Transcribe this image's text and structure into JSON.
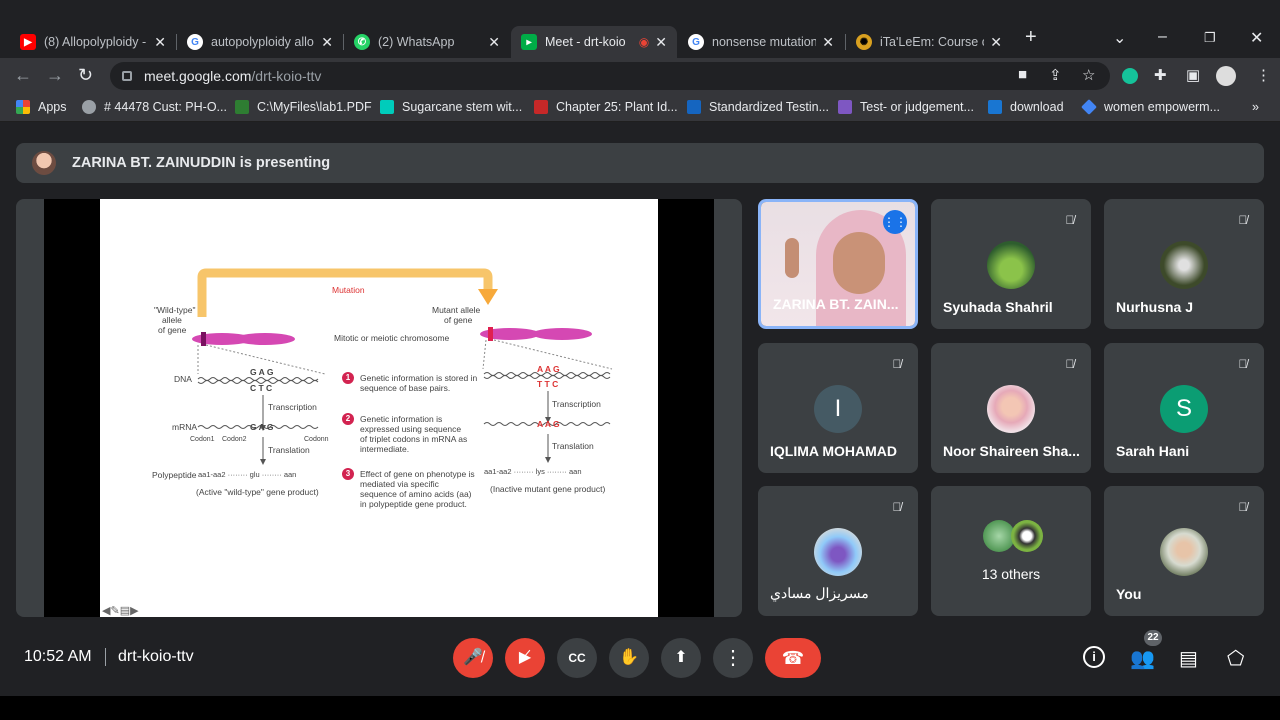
{
  "browser": {
    "tabs": [
      {
        "title": "(8) Allopolyploidy -",
        "icon": "youtube-icon",
        "color": "#ff0000"
      },
      {
        "title": "autopolyploidy allo",
        "icon": "google-icon",
        "color": "#4285f4"
      },
      {
        "title": "(2) WhatsApp",
        "icon": "whatsapp-icon",
        "color": "#25d366"
      },
      {
        "title": "Meet - drt-koio",
        "icon": "meet-icon",
        "color": "#00ac47"
      },
      {
        "title": "nonsense mutation",
        "icon": "google-icon",
        "color": "#4285f4"
      },
      {
        "title": "iTa'LeEm: Course ca",
        "icon": "italeem-icon",
        "color": "#d8a020"
      }
    ],
    "url_domain": "meet.google.com",
    "url_path": "/drt-koio-ttv",
    "bookmarks": [
      {
        "label": "Apps",
        "icon": "apps-grid-icon",
        "color": "#ea4335"
      },
      {
        "label": "# 44478 Cust: PH-O...",
        "icon": "globe-icon",
        "color": "#9aa0a6"
      },
      {
        "label": "C:\\MyFiles\\lab1.PDF",
        "icon": "folder-icon",
        "color": "#2e7d32"
      },
      {
        "label": "Sugarcane stem wit...",
        "icon": "researchgate-icon",
        "color": "#00ccbb"
      },
      {
        "label": "Chapter 25: Plant Id...",
        "icon": "page-icon",
        "color": "#c62828"
      },
      {
        "label": "Standardized Testin...",
        "icon": "shield-icon",
        "color": "#1565c0"
      },
      {
        "label": "Test- or judgement...",
        "icon": "image-icon",
        "color": "#7e57c2"
      },
      {
        "label": "download",
        "icon": "download-icon",
        "color": "#1976d2"
      },
      {
        "label": "women empowerm...",
        "icon": "diamond-icon",
        "color": "#4285f4"
      }
    ],
    "bookmarks_more": "»"
  },
  "meet": {
    "banner_text": "ZARINA BT. ZAINUDDIN is presenting",
    "participants": [
      {
        "name": "ZARINA BT. ZAIN...",
        "speaking": true
      },
      {
        "name": "Syuhada Shahril",
        "muted": true
      },
      {
        "name": "Nurhusna J",
        "muted": true
      },
      {
        "name": "IQLIMA MOHAMAD",
        "initial": "I",
        "muted": true,
        "color": "#455a64"
      },
      {
        "name": "Noor Shaireen Sha...",
        "muted": true
      },
      {
        "name": "Sarah Hani",
        "initial": "S",
        "muted": true,
        "color": "#0b9d73"
      },
      {
        "name": "مسريزال مسادي",
        "muted": true
      },
      {
        "name": "13 others"
      },
      {
        "name": "You",
        "muted": true
      }
    ],
    "time": "10:52 AM",
    "meeting_code": "drt-koio-ttv",
    "people_count": "22"
  },
  "slide": {
    "mutation": "Mutation",
    "wild_type": "\"Wild-type\"",
    "allele": "allele",
    "of_gene": "of gene",
    "mutant_allele": "Mutant allele",
    "mutant_of_gene": "of gene",
    "chromosome": "Mitotic or meiotic chromosome",
    "dna": "DNA",
    "mrna": "mRNA",
    "polypeptide": "Polypeptide",
    "transcription": "Transcription",
    "translation": "Translation",
    "codon1": "Codon1",
    "codon2": "Codon2",
    "codonn": "Codonn",
    "step1": "Genetic information is stored in sequence of base pairs.",
    "step2": "Genetic information is expressed using sequence of triplet codons in mRNA as intermediate.",
    "step3": "Effect of gene on phenotype is mediated via specific sequence of amino acids (aa) in polypeptide gene product.",
    "active": "(Active \"wild-type\" gene product)",
    "inactive": "(Inactive mutant gene product)",
    "gag_top": "G A G",
    "ctc_bottom": "C T C",
    "mut_top": "A A G",
    "mut_bottom": "T T C",
    "mrna_wild": "G A G",
    "mrna_mut": "A A G",
    "pp_wild": "aa1-aa2 ········ glu ········ aan",
    "pp_mut": "aa1-aa2 ········ lys ········ aan"
  }
}
